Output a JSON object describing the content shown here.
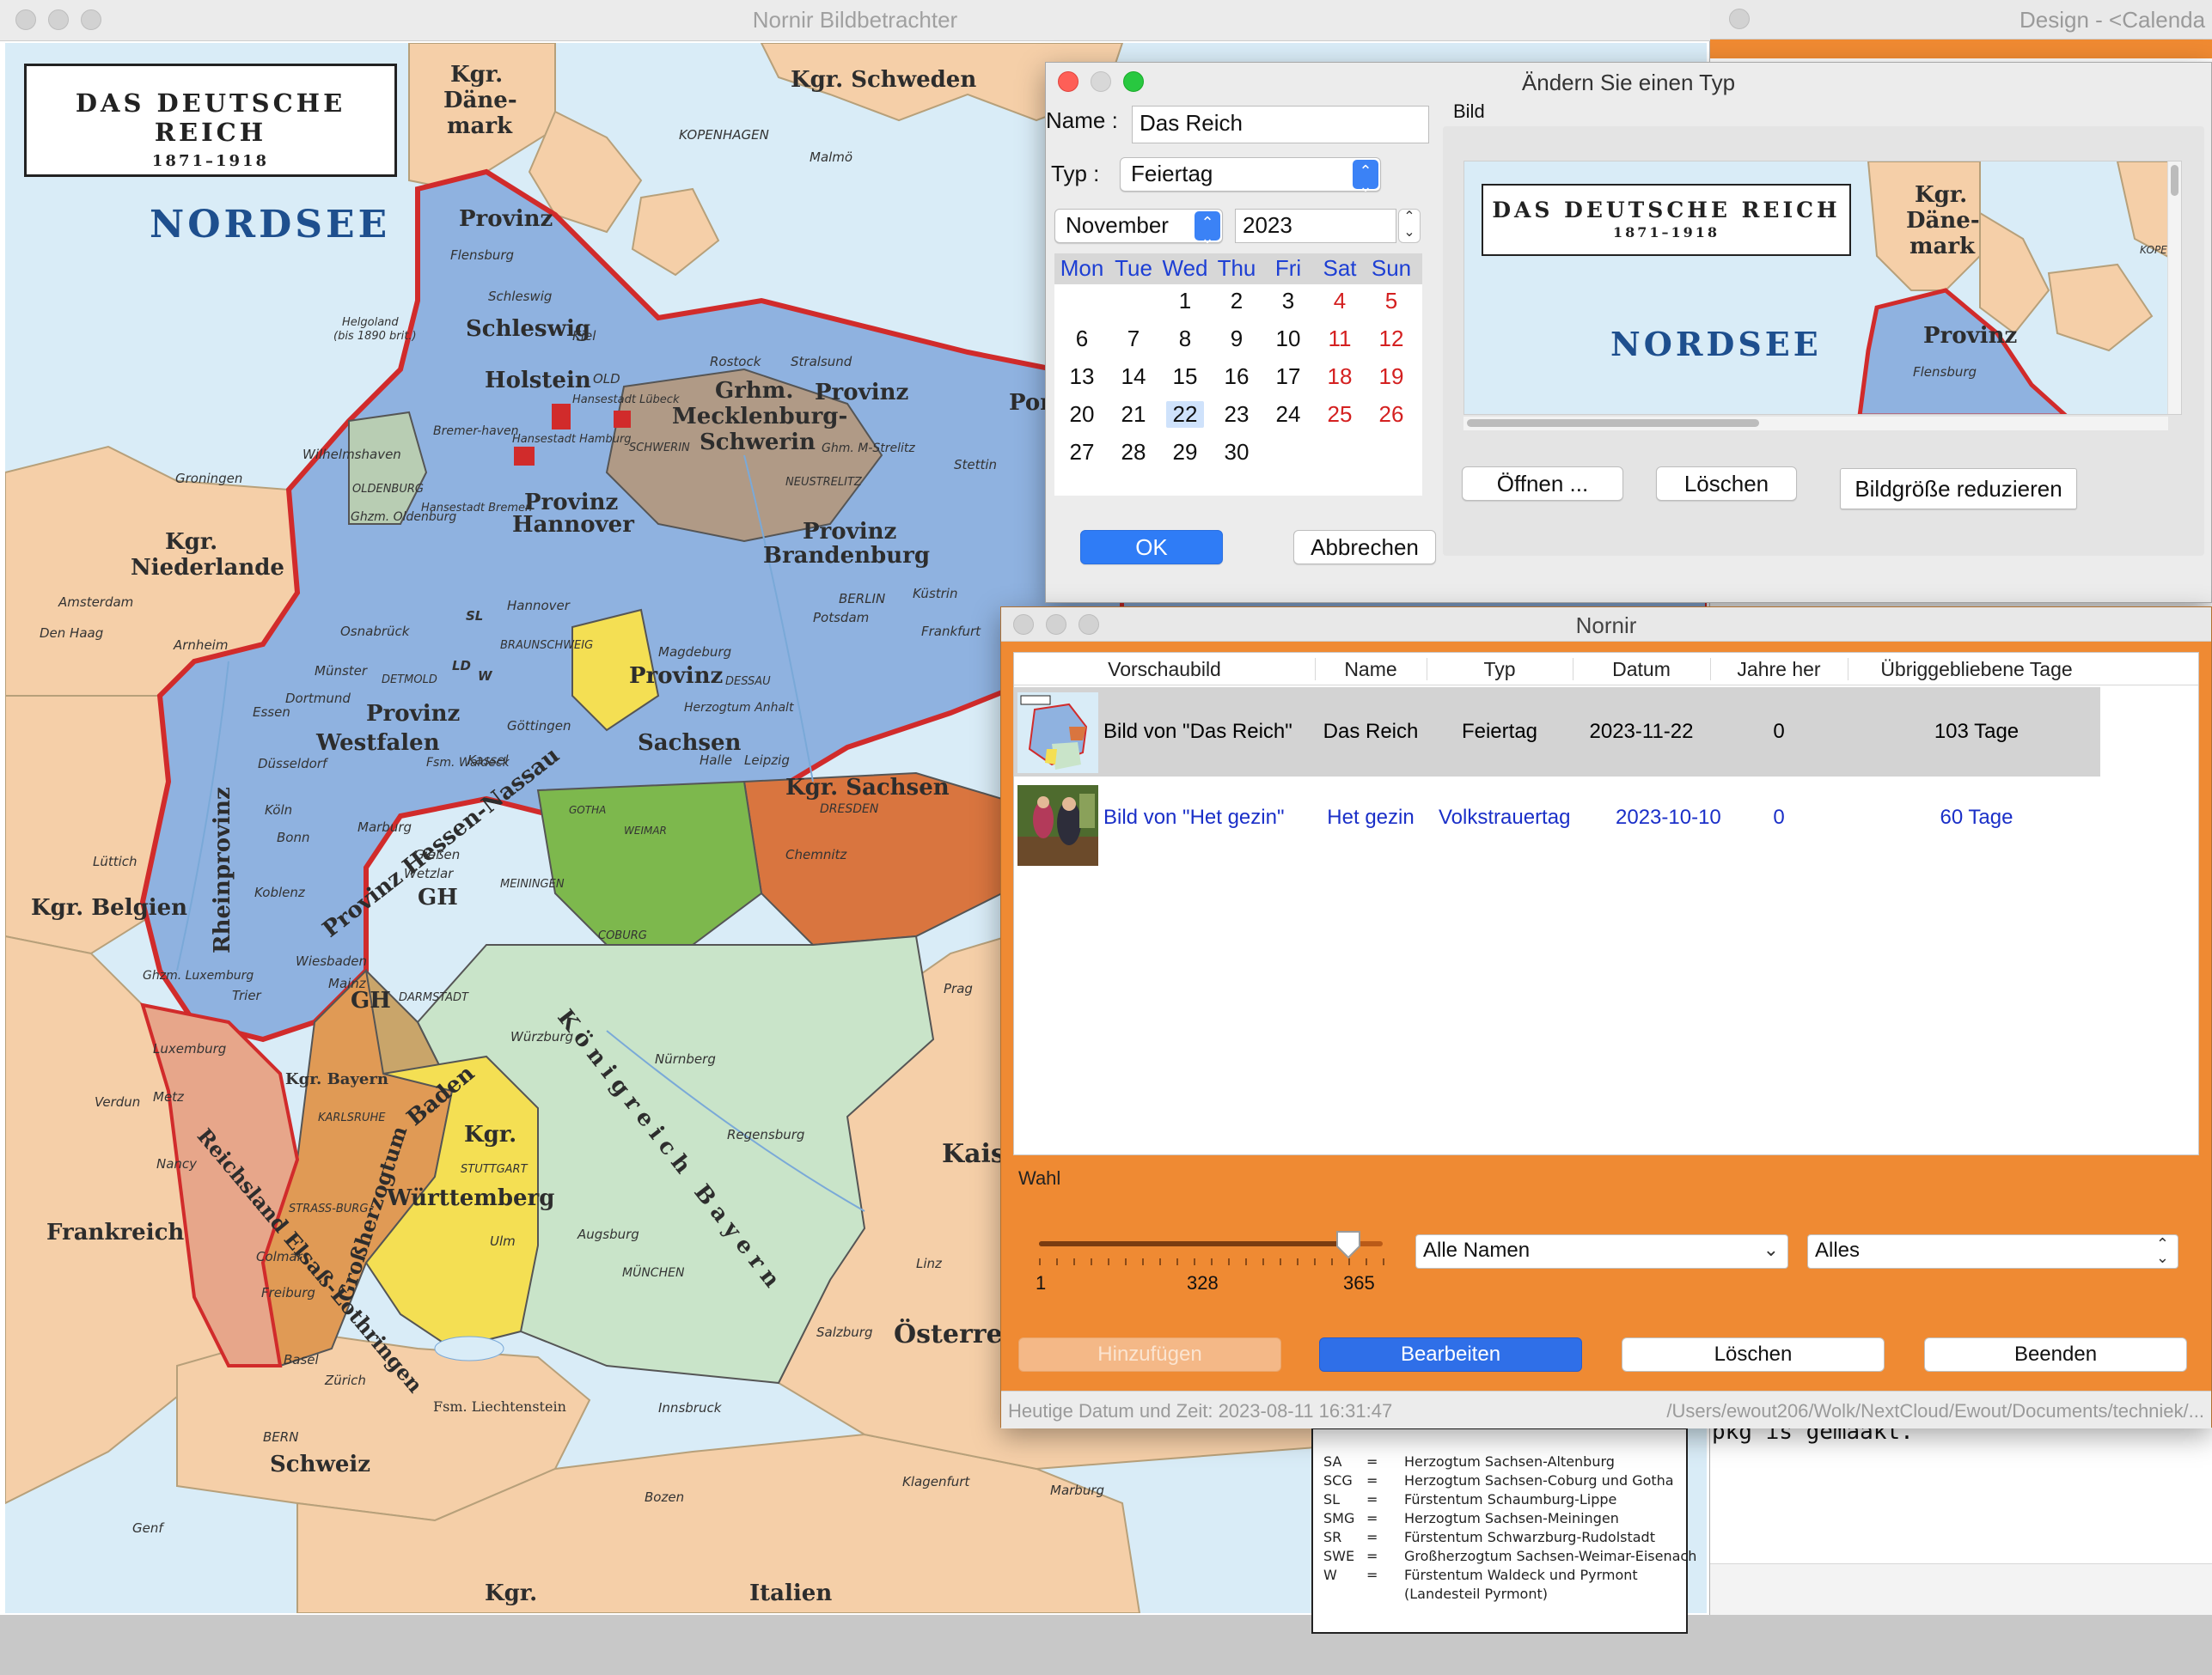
{
  "background_window": {
    "title": "Design - <Calenda",
    "code_text": "pkg is gemaakt."
  },
  "viewer_window": {
    "title": "Nornir Bildbetrachter",
    "map": {
      "title_line1": "DAS DEUTSCHE REICH",
      "title_line2": "1871–1918",
      "sea": "NORDSEE",
      "labels": {
        "kgr_schweden": "Kgr. Schweden",
        "kgr_daenemark_1": "Kgr.",
        "kgr_daenemark_2": "Däne-",
        "kgr_daenemark_3": "mark",
        "kopenhagen": "KOPENHAGEN",
        "malmoe": "Malmö",
        "provinz_sh_1": "Provinz",
        "provinz_sh_2": "Schleswig",
        "flensburg": "Flensburg",
        "schleswig": "Schleswig",
        "kiel": "Kiel",
        "holstein": "Holstein",
        "helgoland_1": "Helgoland",
        "helgoland_2": "(bis 1890 brit.)",
        "grhm_1": "Grhm.",
        "grhm_2": "Mecklenburg-",
        "grhm_3": "Schwerin",
        "rostock": "Rostock",
        "stralsund": "Stralsund",
        "provinz_pom": "Provinz",
        "pom": "Pom",
        "old": "OLD",
        "hansestadt_luebeck": "Hansestadt Lübeck",
        "hansestadt_hamburg": "Hansestadt Hamburg",
        "hansestadt_bremen": "Hansestadt Bremen",
        "schwerin": "SCHWERIN",
        "grhm_strelitz": "Ghm. M-Strelitz",
        "neustrelitz": "NEUSTRELITZ",
        "stettin": "Stettin",
        "bremerhaven": "Bremer-haven",
        "wilhelmshaven": "Wilhelmshaven",
        "groningen": "Groningen",
        "oldenburg": "OLDENBURG",
        "ghzm_oldenburg": "Ghzm. Oldenburg",
        "provinz_hannover_1": "Provinz",
        "provinz_hannover_2": "Hannover",
        "provinz_brandenburg_1": "Provinz",
        "provinz_brandenburg_2": "Brandenburg",
        "kgr_niederlande_1": "Kgr.",
        "kgr_niederlande_2": "Niederlande",
        "amsterdam": "Amsterdam",
        "den_haag": "Den Haag",
        "arnheim": "Arnheim",
        "hannover": "Hannover",
        "berlin": "BERLIN",
        "potsdam": "Potsdam",
        "kuestrin": "Küstrin",
        "frankfurt": "Frankfurt",
        "braunschweig": "BRAUNSCHWEIG",
        "osnabrueck": "Osnabrück",
        "magdeburg": "Magdeburg",
        "sl": "SL",
        "ld": "LD",
        "w": "W",
        "muenster": "Münster",
        "detmold": "DETMOLD",
        "provinz_sachsen_1": "Provinz",
        "provinz_sachsen_2": "Sachsen",
        "dessau": "DESSAU",
        "herzogtum_anhalt": "Herzogtum Anhalt",
        "provinz_westfalen_1": "Provinz",
        "provinz_westfalen_2": "Westfalen",
        "dortmund": "Dortmund",
        "essen": "Essen",
        "duesseldorf": "Düsseldorf",
        "fsm_waldeck": "Fsm. Waldeck",
        "kassel": "Kassel",
        "goettingen": "Göttingen",
        "halle": "Halle",
        "leipzig": "Leipzig",
        "kgr_sachsen": "Kgr. Sachsen",
        "dresden": "DRESDEN",
        "chemnitz": "Chemnitz",
        "rheinprovinz": "Rheinprovinz",
        "koeln": "Köln",
        "bonn": "Bonn",
        "koblenz": "Koblenz",
        "provinz_hessen_nassau": "Provinz Hessen-Nassau",
        "marburg": "Marburg",
        "giessen": "Gießen",
        "wetzlar": "Wetzlar",
        "gh": "GH",
        "gotha": "GOTHA",
        "weimar": "WEIMAR",
        "meiningen": "MEININGEN",
        "coburg": "COBURG",
        "kgr_belgien": "Kgr. Belgien",
        "luettich": "Lüttich",
        "ghzm_luxemburg": "Ghzm. Luxemburg",
        "luxemburg": "Luxemburg",
        "trier": "Trier",
        "wiesbaden": "Wiesbaden",
        "mainz": "Mainz",
        "darmstadt": "DARMSTADT",
        "wuerzburg": "Würzburg",
        "nuernberg": "Nürnberg",
        "regensburg": "Regensburg",
        "prag": "Prag",
        "koenigreich_bayern": "Königreich Bayern",
        "kgr_bayern": "Kgr. Bayern",
        "karlsruhe": "KARLSRUHE",
        "baden": "Baden",
        "grossherzogtum": "Großherzogtum",
        "kgr_wuerttemberg_1": "Kgr.",
        "kgr_wuerttemberg_2": "Württemberg",
        "stuttgart": "STUTTGART",
        "reichsland": "Reichsland Elsaß-Lothringen",
        "metz": "Metz",
        "verdun": "Verdun",
        "nancy": "Nancy",
        "strassburg": "STRASS-BURG",
        "colmar": "Colmar",
        "freiburg": "Freiburg",
        "ulm": "Ulm",
        "augsburg": "Augsburg",
        "muenchen": "MÜNCHEN",
        "linz": "Linz",
        "salzburg": "Salzburg",
        "frankreich": "Frankreich",
        "basel": "Basel",
        "zuerich": "Zürich",
        "fsm_liechtenstein": "Fsm. Liechtenstein",
        "innsbruck": "Innsbruck",
        "schweiz": "Schweiz",
        "bern": "BERN",
        "genf": "Genf",
        "kgr_bottom": "Kgr.",
        "italien": "Italien",
        "bozen": "Bozen",
        "klagenfurt": "Klagenfurt",
        "marburg_drau": "Marburg",
        "kais": "Kais",
        "oesterr": "Österre"
      },
      "legend": [
        {
          "abbr": "SA",
          "text": "Herzogtum Sachsen-Altenburg"
        },
        {
          "abbr": "SCG",
          "text": "Herzogtum Sachsen-Coburg und Gotha"
        },
        {
          "abbr": "SL",
          "text": "Fürstentum Schaumburg-Lippe"
        },
        {
          "abbr": "SMG",
          "text": "Herzogtum Sachsen-Meiningen"
        },
        {
          "abbr": "SR",
          "text": "Fürstentum Schwarzburg-Rudolstadt"
        },
        {
          "abbr": "SWE",
          "text": "Großherzogtum Sachsen-Weimar-Eisenach"
        },
        {
          "abbr": "W",
          "text": "Fürstentum Waldeck und Pyrmont"
        },
        {
          "abbr": "",
          "text": "(Landesteil Pyrmont)"
        }
      ],
      "legend_eq": "="
    }
  },
  "dialog": {
    "title": "Ändern Sie einen Typ",
    "name_label": "Name :",
    "name_value": "Das Reich",
    "typ_label": "Typ :",
    "typ_value": "Feiertag",
    "month_value": "November",
    "year_value": "2023",
    "bild_label": "Bild",
    "calendar": {
      "weekdays": [
        "Mon",
        "Tue",
        "Wed",
        "Thu",
        "Fri",
        "Sat",
        "Sun"
      ],
      "weeks": [
        [
          "",
          "",
          "1",
          "2",
          "3",
          "4",
          "5"
        ],
        [
          "6",
          "7",
          "8",
          "9",
          "10",
          "11",
          "12"
        ],
        [
          "13",
          "14",
          "15",
          "16",
          "17",
          "18",
          "19"
        ],
        [
          "20",
          "21",
          "22",
          "23",
          "24",
          "25",
          "26"
        ],
        [
          "27",
          "28",
          "29",
          "30",
          "",
          "",
          ""
        ]
      ],
      "selected": "22",
      "weekend_color": "#d42020",
      "weekday_header_color": "#1d3fd4"
    },
    "buttons": {
      "open": "Öffnen ...",
      "delete": "Löschen",
      "reduce": "Bildgröße reduzieren",
      "ok": "OK",
      "cancel": "Abbrechen"
    }
  },
  "nornir": {
    "title": "Nornir",
    "columns": [
      "Vorschaubild",
      "Name",
      "Typ",
      "Datum",
      "Jahre her",
      "Übriggebliebene Tage"
    ],
    "rows": [
      {
        "preview": "Bild von \"Das Reich\"",
        "name": "Das Reich",
        "typ": "Feiertag",
        "datum": "2023-11-22",
        "jahre": "0",
        "tage": "103 Tage",
        "color": "#111111"
      },
      {
        "preview": "Bild von \"Het gezin\"",
        "name": "Het gezin",
        "typ": "Volkstrauertag",
        "datum": "2023-10-10",
        "jahre": "0",
        "tage": "60 Tage",
        "color": "#1a2fc8"
      }
    ],
    "wahl_label": "Wahl",
    "slider": {
      "min": "1",
      "mid": "328",
      "max": "365",
      "fraction": 0.9
    },
    "name_filter": "Alle Namen",
    "type_filter": "Alles",
    "buttons": {
      "add": "Hinzufügen",
      "edit": "Bearbeiten",
      "delete": "Löschen",
      "quit": "Beenden"
    },
    "status_left": "Heutige Datum und Zeit: 2023-08-11 16:31:47",
    "status_right": "/Users/ewout206/Wolk/NextCloud/Ewout/Documents/techniek/..."
  },
  "colors": {
    "orange": "#ef8a33",
    "blue_button": "#2f6fe8",
    "prussia": "#8fb2e0",
    "sea": "#d9ecf7"
  }
}
